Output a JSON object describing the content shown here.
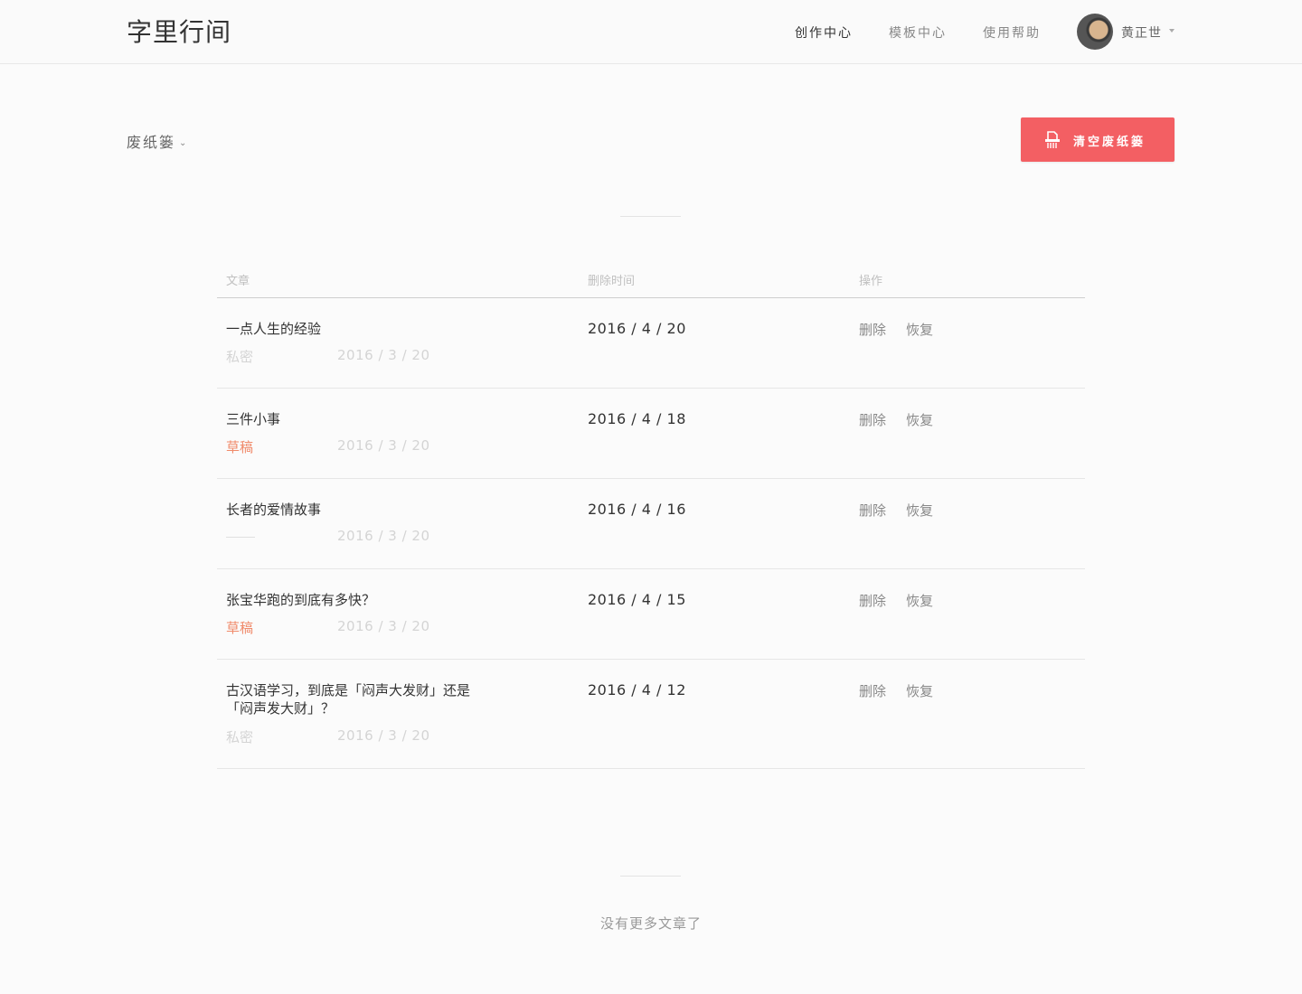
{
  "header": {
    "logo": "字里行间",
    "nav": [
      {
        "label": "创作中心",
        "active": true
      },
      {
        "label": "模板中心",
        "active": false
      },
      {
        "label": "使用帮助",
        "active": false
      }
    ],
    "user": {
      "name": "黄正世"
    }
  },
  "toolbar": {
    "folder_label": "废纸篓",
    "clear_button": "清空废纸篓",
    "accent": "#f35f63"
  },
  "table": {
    "columns": [
      "文章",
      "删除时间",
      "操作"
    ],
    "actions": {
      "delete": "删除",
      "restore": "恢复"
    },
    "rows": [
      {
        "title": "一点人生的经验",
        "status": "私密",
        "status_type": "private",
        "created": "2016 / 3 / 20",
        "deleted": "2016 / 4 / 20"
      },
      {
        "title": "三件小事",
        "status": "草稿",
        "status_type": "draft",
        "created": "2016 / 3 / 20",
        "deleted": "2016 / 4 / 18"
      },
      {
        "title": "长者的爱情故事",
        "status": "",
        "status_type": "none",
        "created": "2016 / 3 / 20",
        "deleted": "2016 / 4 / 16"
      },
      {
        "title": "张宝华跑的到底有多快？",
        "status": "草稿",
        "status_type": "draft",
        "created": "2016 / 3 / 20",
        "deleted": "2016 / 4 / 15"
      },
      {
        "title": "古汉语学习，到底是「闷声大发财」还是「闷声发大财」？",
        "status": "私密",
        "status_type": "private",
        "created": "2016 / 3 / 20",
        "deleted": "2016 / 4 / 12"
      }
    ]
  },
  "footer": {
    "end_text": "没有更多文章了"
  },
  "colors": {
    "draft": "#f08a6a",
    "private": "#d4d4d4"
  }
}
